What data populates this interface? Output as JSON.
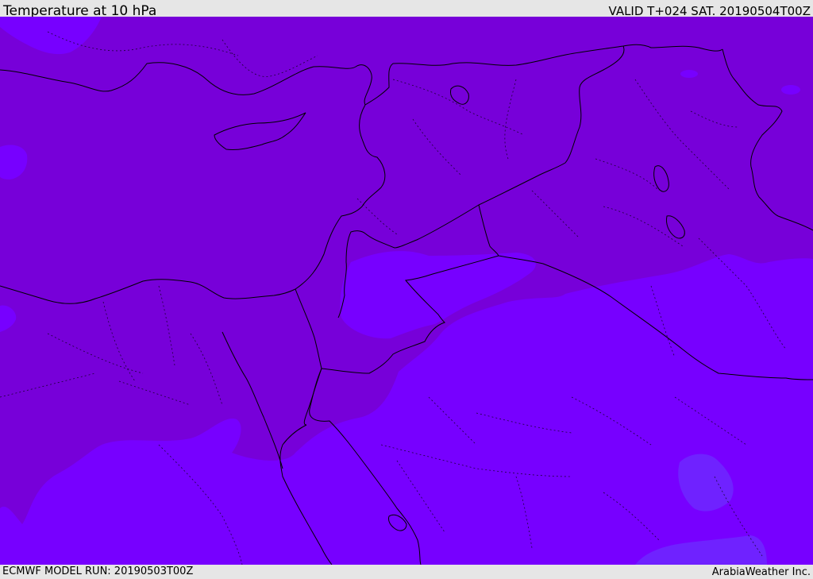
{
  "header": {
    "title": "Temperature at 10 hPa",
    "valid": "VALID T+024 SAT. 20190504T00Z"
  },
  "footer": {
    "model_run": "ECMWF MODEL RUN: 20190503T00Z",
    "credit": "ArabiaWeather Inc."
  },
  "colors": {
    "band_cold": "#7700d9",
    "band_mid": "#7700ff",
    "band_warm": "#6f22ff",
    "borders": "#000000",
    "bar_background": "#e6e6e6"
  },
  "map": {
    "field": "temperature",
    "level": "10 hPa",
    "region": "Eastern Mediterranean / Middle East"
  }
}
